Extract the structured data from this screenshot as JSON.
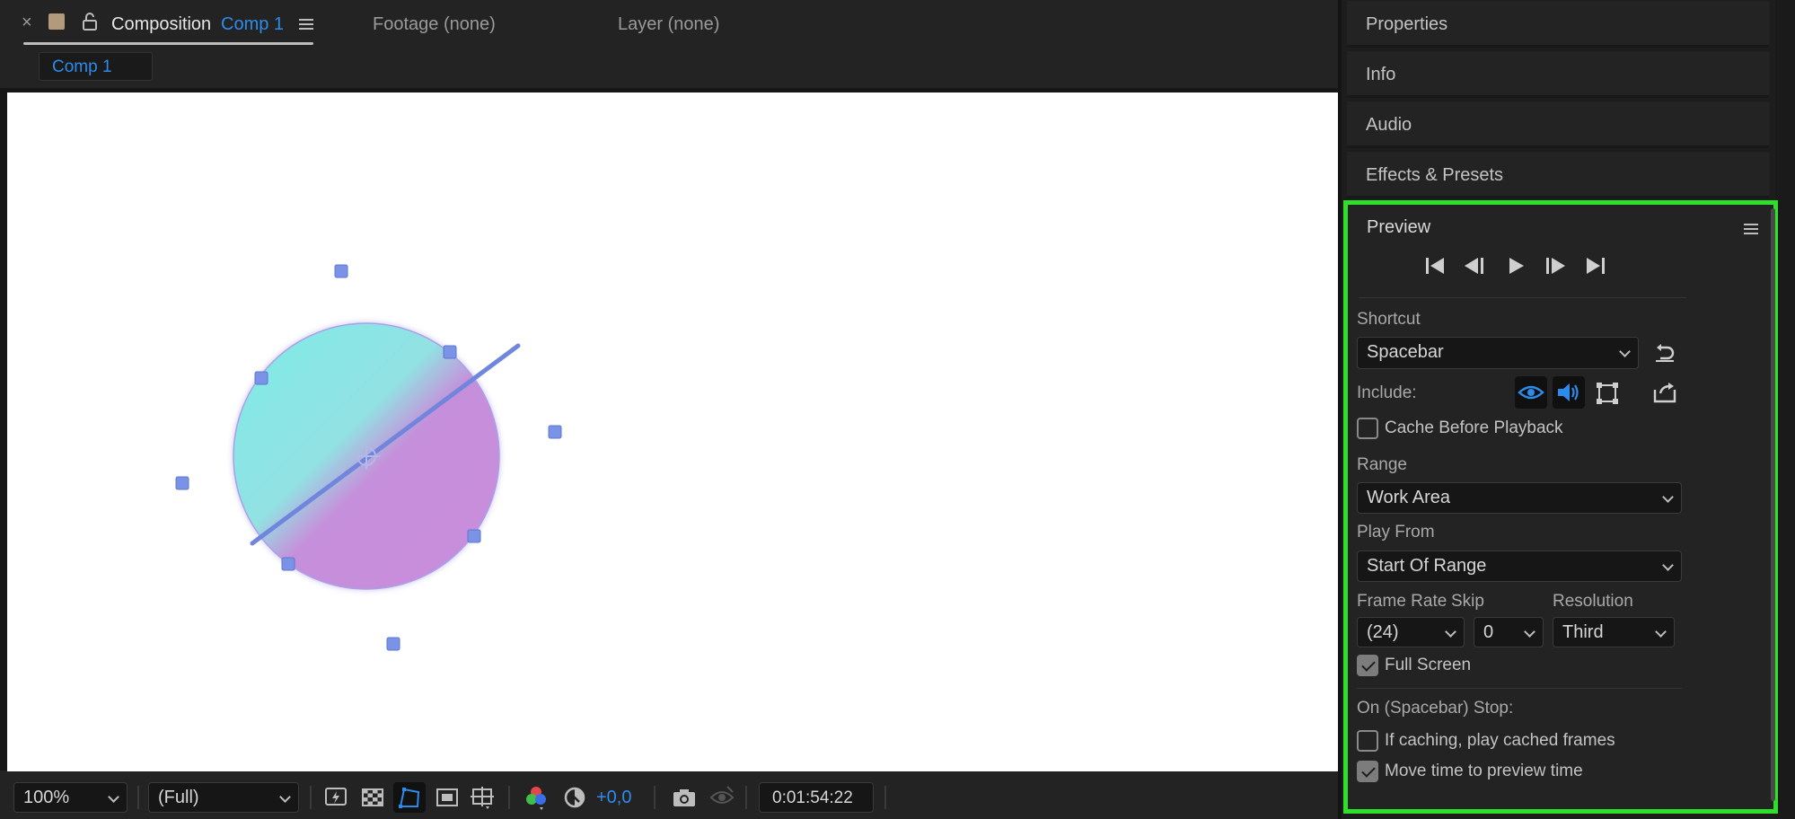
{
  "composition_tab": {
    "close_icon": "×",
    "label": "Composition",
    "comp_name": "Comp 1",
    "footage_tab": "Footage (none)",
    "layer_tab": "Layer (none)",
    "subtab": "Comp 1"
  },
  "footer": {
    "zoom": "100%",
    "resolution": "(Full)",
    "exposure": "+0,0",
    "timecode": "0:01:54:22"
  },
  "panels": {
    "properties": "Properties",
    "info": "Info",
    "audio": "Audio",
    "effects": "Effects & Presets"
  },
  "preview": {
    "title": "Preview",
    "shortcut_label": "Shortcut",
    "shortcut_value": "Spacebar",
    "include_label": "Include:",
    "cache_before_playback": "Cache Before Playback",
    "range_label": "Range",
    "range_value": "Work Area",
    "play_from_label": "Play From",
    "play_from_value": "Start Of Range",
    "frame_rate_label": "Frame Rate",
    "frame_rate_value": "(24)",
    "skip_label": "Skip",
    "skip_value": "0",
    "resolution_label": "Resolution",
    "resolution_value": "Third",
    "full_screen": "Full Screen",
    "on_stop_label": "On (Spacebar) Stop:",
    "if_caching": "If caching, play cached frames",
    "move_time": "Move time to preview time"
  },
  "colors": {
    "accent_blue": "#2d8ceb",
    "highlight_green": "#2ee02a",
    "handle_blue": "#7b93e6"
  }
}
